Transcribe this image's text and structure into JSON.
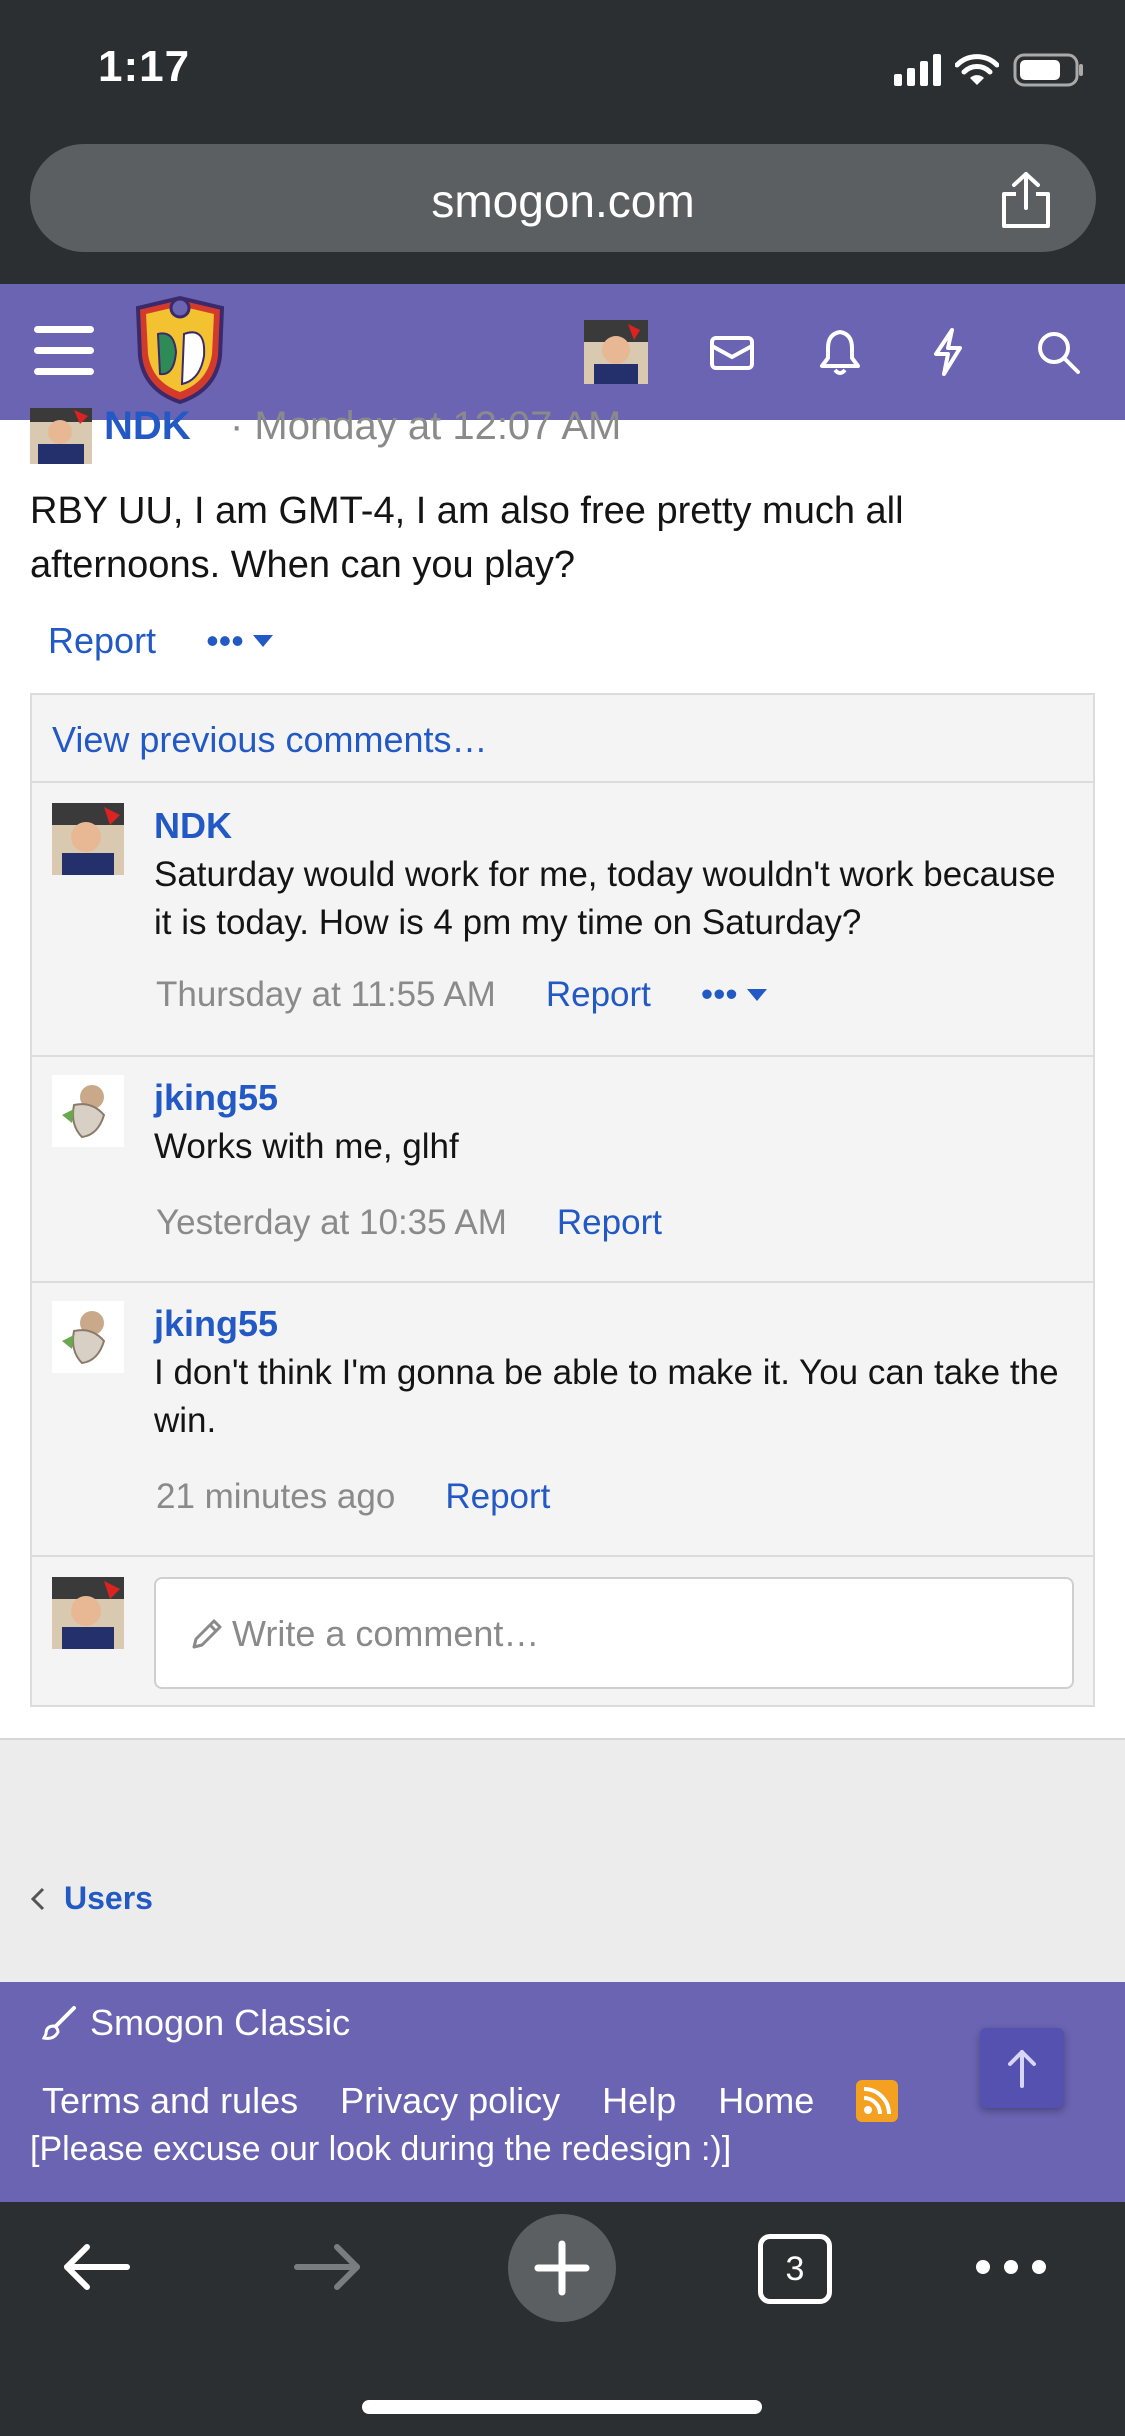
{
  "status_bar": {
    "time": "1:17"
  },
  "browser": {
    "url": "smogon.com",
    "tab_count": "3"
  },
  "site_header": {
    "icons": [
      "hamburger-menu-icon",
      "site-logo",
      "user-avatar",
      "mail-icon",
      "bell-icon",
      "bolt-icon",
      "search-icon"
    ],
    "accent_color": "#6a64b3"
  },
  "post": {
    "author": "NDK",
    "date": "· Monday at 12:07 AM",
    "body": "RBY UU, I am GMT-4, I am also free pretty much all afternoons. When can you play?",
    "report_label": "Report",
    "more_label": "•••"
  },
  "comments": {
    "view_previous": "View previous comments…",
    "items": [
      {
        "author": "NDK",
        "text": "Saturday would work for me, today wouldn't work because it is today. How is 4 pm my time on Saturday?",
        "time": "Thursday at 11:55 AM",
        "report": "Report",
        "more": "•••"
      },
      {
        "author": "jking55",
        "text": "Works with me, glhf",
        "time": "Yesterday at 10:35 AM",
        "report": "Report"
      },
      {
        "author": "jking55",
        "text": "I don't think I'm gonna be able to make it. You can take the win.",
        "time": "21 minutes ago",
        "report": "Report"
      }
    ],
    "write_placeholder": "Write a comment…"
  },
  "breadcrumb": {
    "label": "Users"
  },
  "footer": {
    "style_name": "Smogon Classic",
    "links": [
      "Terms and rules",
      "Privacy policy",
      "Help",
      "Home"
    ],
    "note": "[Please excuse our look during the redesign :)]"
  },
  "colors": {
    "link": "#2359c4",
    "header": "#6a64b3",
    "browser_chrome": "#2c2f31"
  }
}
